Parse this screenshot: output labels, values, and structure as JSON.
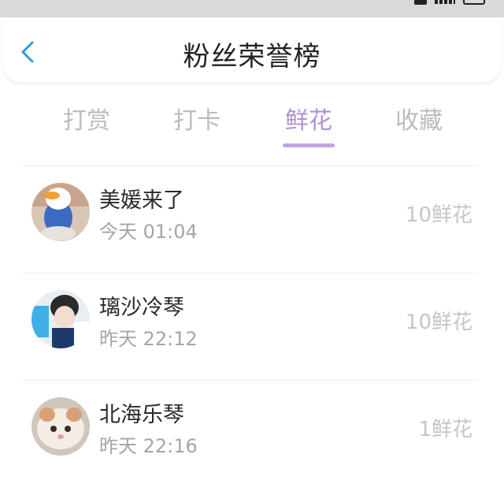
{
  "header": {
    "title": "粉丝荣誉榜"
  },
  "tabs": [
    {
      "label": "打赏"
    },
    {
      "label": "打卡"
    },
    {
      "label": "鲜花"
    },
    {
      "label": "收藏"
    }
  ],
  "active_tab": "鲜花",
  "list": [
    {
      "name": "美媛来了",
      "time": "今天 01:04",
      "amount": "10鲜花"
    },
    {
      "name": "璃沙冷琴",
      "time": "昨天 22:12",
      "amount": "10鲜花"
    },
    {
      "name": "北海乐琴",
      "time": "昨天 22:16",
      "amount": "1鲜花"
    }
  ],
  "icons": {
    "back": "chevron-left-icon",
    "avatar": "avatar"
  },
  "colors": {
    "accent": "#b48fd6",
    "underline": "#c3a3e2",
    "back": "#2f9be0"
  }
}
